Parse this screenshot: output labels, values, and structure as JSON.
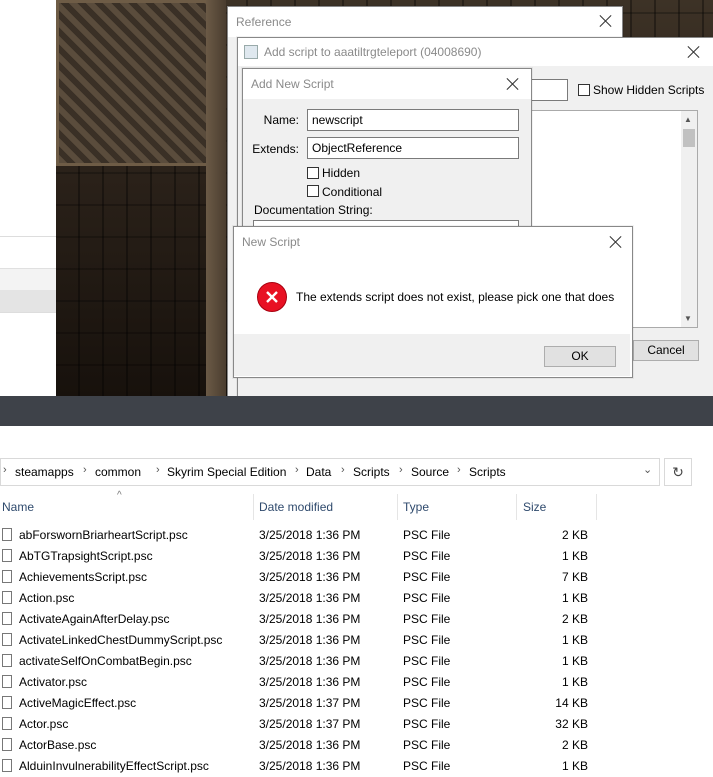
{
  "reference_dialog": {
    "title": "Reference"
  },
  "add_script_dialog": {
    "title": "Add script to aaatiltrgteleport (04008690)",
    "show_hidden_label": "Show Hidden Scripts",
    "cancel_label": "Cancel"
  },
  "new_script_form": {
    "title": "Add New Script",
    "name_label": "Name:",
    "name_value": "newscript",
    "extends_label": "Extends:",
    "extends_value": "ObjectReference",
    "hidden_label": "Hidden",
    "conditional_label": "Conditional",
    "doc_label": "Documentation String:"
  },
  "error_dialog": {
    "title": "New Script",
    "message": "The extends script does not exist, please pick one that does",
    "ok_label": "OK",
    "icon": "error-icon",
    "icon_color": "#e81123"
  },
  "explorer": {
    "breadcrumbs": [
      "steamapps",
      "common",
      "Skyrim Special Edition",
      "Data",
      "Scripts",
      "Source",
      "Scripts"
    ],
    "columns": {
      "name": "Name",
      "date": "Date modified",
      "type": "Type",
      "size": "Size"
    },
    "files": [
      {
        "name": "abForswornBriarheartScript.psc",
        "date": "3/25/2018 1:36 PM",
        "type": "PSC File",
        "size": "2 KB"
      },
      {
        "name": "AbTGTrapsightScript.psc",
        "date": "3/25/2018 1:36 PM",
        "type": "PSC File",
        "size": "1 KB"
      },
      {
        "name": "AchievementsScript.psc",
        "date": "3/25/2018 1:36 PM",
        "type": "PSC File",
        "size": "7 KB"
      },
      {
        "name": "Action.psc",
        "date": "3/25/2018 1:36 PM",
        "type": "PSC File",
        "size": "1 KB"
      },
      {
        "name": "ActivateAgainAfterDelay.psc",
        "date": "3/25/2018 1:36 PM",
        "type": "PSC File",
        "size": "2 KB"
      },
      {
        "name": "ActivateLinkedChestDummyScript.psc",
        "date": "3/25/2018 1:36 PM",
        "type": "PSC File",
        "size": "1 KB"
      },
      {
        "name": "activateSelfOnCombatBegin.psc",
        "date": "3/25/2018 1:36 PM",
        "type": "PSC File",
        "size": "1 KB"
      },
      {
        "name": "Activator.psc",
        "date": "3/25/2018 1:36 PM",
        "type": "PSC File",
        "size": "1 KB"
      },
      {
        "name": "ActiveMagicEffect.psc",
        "date": "3/25/2018 1:37 PM",
        "type": "PSC File",
        "size": "14 KB"
      },
      {
        "name": "Actor.psc",
        "date": "3/25/2018 1:37 PM",
        "type": "PSC File",
        "size": "32 KB"
      },
      {
        "name": "ActorBase.psc",
        "date": "3/25/2018 1:36 PM",
        "type": "PSC File",
        "size": "2 KB"
      },
      {
        "name": "AlduinInvulnerabilityEffectScript.psc",
        "date": "3/25/2018 1:36 PM",
        "type": "PSC File",
        "size": "1 KB"
      }
    ]
  }
}
